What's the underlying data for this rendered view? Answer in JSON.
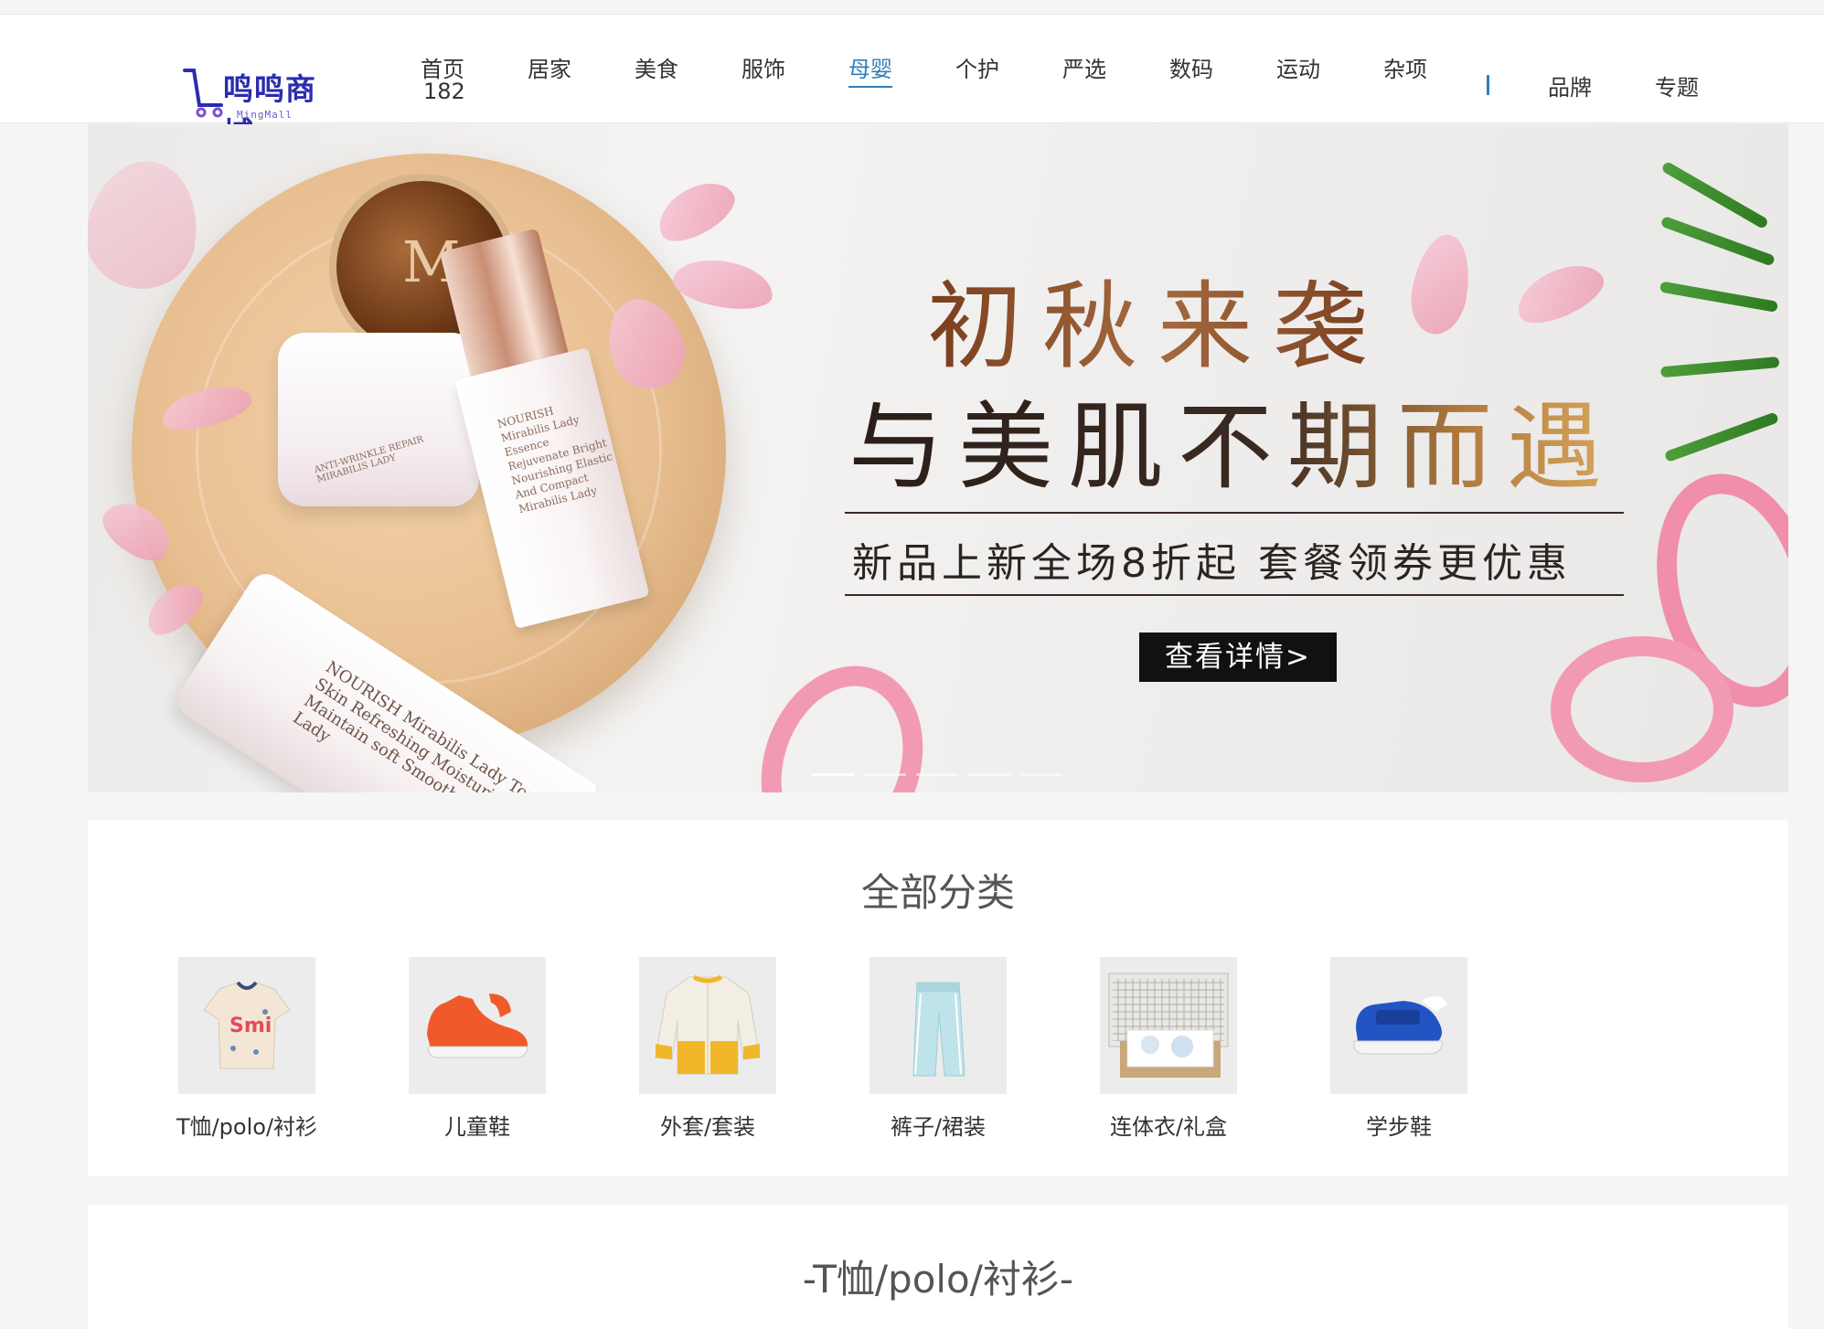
{
  "header": {
    "logo": {
      "text": "鸣鸣商城",
      "sub": "MingMall"
    },
    "nav": [
      {
        "label": "首页",
        "active": false
      },
      {
        "label": "居家",
        "active": false
      },
      {
        "label": "美食",
        "active": false
      },
      {
        "label": "服饰",
        "active": false
      },
      {
        "label": "母婴",
        "active": true
      },
      {
        "label": "个护",
        "active": false
      },
      {
        "label": "严选",
        "active": false
      },
      {
        "label": "数码",
        "active": false
      },
      {
        "label": "运动",
        "active": false
      },
      {
        "label": "杂项",
        "active": false
      }
    ],
    "nav_extra": "182",
    "right_nav": [
      {
        "label": "品牌"
      },
      {
        "label": "专题"
      }
    ],
    "accent_color": "#2f7fb8"
  },
  "banner": {
    "title1": "初秋来袭",
    "title2": "与美肌不期而遇",
    "subtitle": "新品上新全场8折起 套餐领券更优惠",
    "button": "查看详情>",
    "product_texts": {
      "lid_logo": "M",
      "jar": "ANTI-WRINKLE REPAIR MIRABILIS LADY",
      "bottle": "NOURISH Mirabilis Lady Essence Rejuvenate Bright Nourishing Elastic And Compact Mirabilis Lady",
      "tube": "NOURISH Mirabilis Lady Toner Skin Refreshing Moisturize Maintain soft Smooth Mirabilis Lady"
    },
    "slides": 5,
    "active_slide": 1
  },
  "categories": {
    "title": "全部分类",
    "items": [
      {
        "label": "T恤/polo/衬衫",
        "icon": "tshirt-icon"
      },
      {
        "label": "儿童鞋",
        "icon": "kids-shoe-icon"
      },
      {
        "label": "外套/套装",
        "icon": "jacket-icon"
      },
      {
        "label": "裤子/裙装",
        "icon": "pants-icon"
      },
      {
        "label": "连体衣/礼盒",
        "icon": "gift-box-icon"
      },
      {
        "label": "学步鞋",
        "icon": "toddler-shoe-icon"
      }
    ]
  },
  "section": {
    "title": "-T恤/polo/衬衫-"
  }
}
